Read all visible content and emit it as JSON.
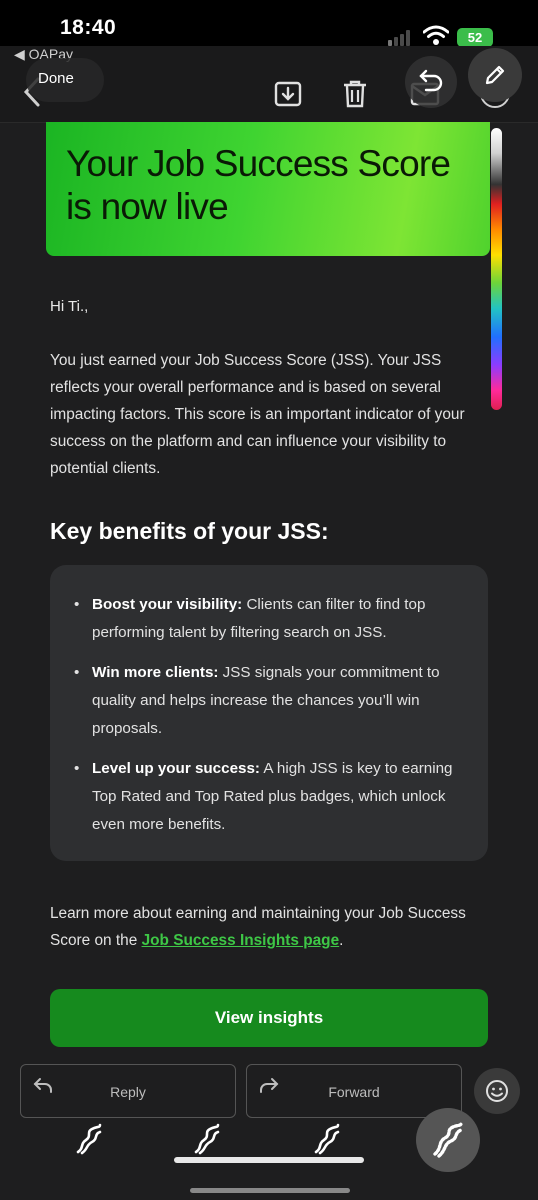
{
  "status_bar": {
    "time": "18:40",
    "back_app": "◀ OAPay",
    "battery": "52"
  },
  "toolbar": {
    "done_label": "Done"
  },
  "email": {
    "banner_title": "Your Job Success Score is now live",
    "greeting": "Hi Ti.,",
    "intro": "You just earned your Job Success Score (JSS). Your JSS reflects your overall performance and is based on several impacting factors. This score is an important indicator of your success on the platform and can influence your visibility to potential clients.",
    "benefits_heading": "Key benefits of your JSS:",
    "benefits": [
      {
        "title": "Boost your visibility:",
        "text": " Clients can filter to find top performing talent by filtering search on JSS."
      },
      {
        "title": "Win more clients:",
        "text": " JSS signals your commitment to quality and helps increase the chances you’ll win proposals."
      },
      {
        "title": "Level up your success:",
        "text": " A high JSS is key to earning Top Rated and Top Rated plus badges, which unlock even more benefits."
      }
    ],
    "learn_more_prefix": "Learn more about earning and maintaining your Job Success Score on the ",
    "learn_more_link": "Job Success Insights page",
    "learn_more_suffix": ".",
    "cta_label": "View insights"
  },
  "actions": {
    "reply_label": "Reply",
    "forward_label": "Forward"
  },
  "colors": {
    "banner_green": "#3fd431",
    "cta_green": "#168a1e",
    "link_green": "#3ec746",
    "background": "#1e1e1f",
    "card": "#2e2f31"
  },
  "icons": [
    "chevron-left-icon",
    "archive-icon",
    "trash-icon",
    "mail-icon",
    "undo-icon",
    "pen-icon",
    "reply-icon",
    "forward-icon",
    "emoji-icon",
    "doodle-icon",
    "wifi-icon",
    "signal-icon"
  ]
}
